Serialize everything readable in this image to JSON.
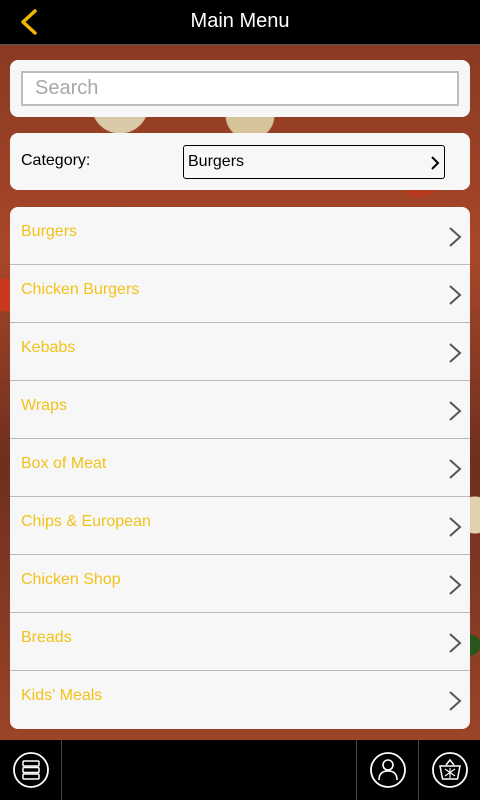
{
  "header": {
    "title": "Main Menu",
    "back_icon": "chevron-left-icon",
    "accent_color": "#f2b705"
  },
  "search": {
    "placeholder": "Search",
    "value": ""
  },
  "category": {
    "label": "Category:",
    "selected": "Burgers"
  },
  "menu": {
    "item_color": "#f2c21a",
    "items": [
      {
        "label": "Burgers"
      },
      {
        "label": "Chicken Burgers"
      },
      {
        "label": "Kebabs"
      },
      {
        "label": "Wraps"
      },
      {
        "label": "Box of Meat"
      },
      {
        "label": "Chips & European"
      },
      {
        "label": "Chicken Shop"
      },
      {
        "label": "Breads"
      },
      {
        "label": "Kids' Meals"
      }
    ]
  },
  "tabbar": {
    "items": [
      {
        "icon": "menu-list-icon"
      },
      {
        "icon": "account-icon"
      },
      {
        "icon": "basket-icon"
      }
    ]
  }
}
